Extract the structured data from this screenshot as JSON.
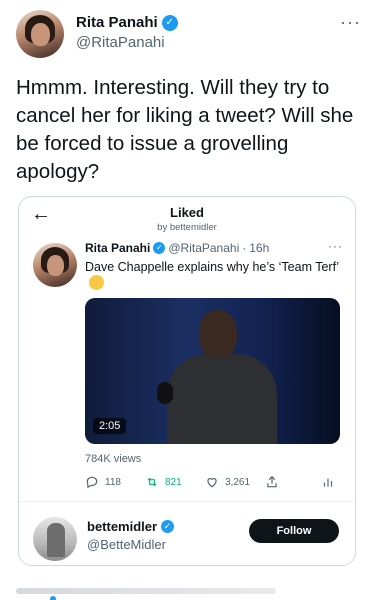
{
  "tweet": {
    "author_name": "Rita Panahi",
    "author_handle": "@RitaPanahi",
    "more": "···",
    "text": "Hmmm. Interesting. Will they try to cancel her for liking a tweet? Will she be forced to issue a grovelling apology?"
  },
  "card": {
    "back": "←",
    "title": "Liked",
    "subtitle": "by bettemidler",
    "inner": {
      "name": "Rita Panahi",
      "handle": "@RitaPanahi",
      "separator": "·",
      "time": "16h",
      "more": "···",
      "text": "Dave Chappelle explains why he’s ‘Team Terf’",
      "video_duration": "2:05",
      "views": "784K views",
      "replies": "118",
      "retweets": "821",
      "likes": "3,261"
    },
    "footer": {
      "name": "bettemidler",
      "handle": "@BetteMidler",
      "follow_label": "Follow"
    }
  },
  "colors": {
    "accent": "#1d9bf0",
    "retweet": "#00ba7c",
    "text": "#0f1419",
    "muted": "#536471"
  }
}
